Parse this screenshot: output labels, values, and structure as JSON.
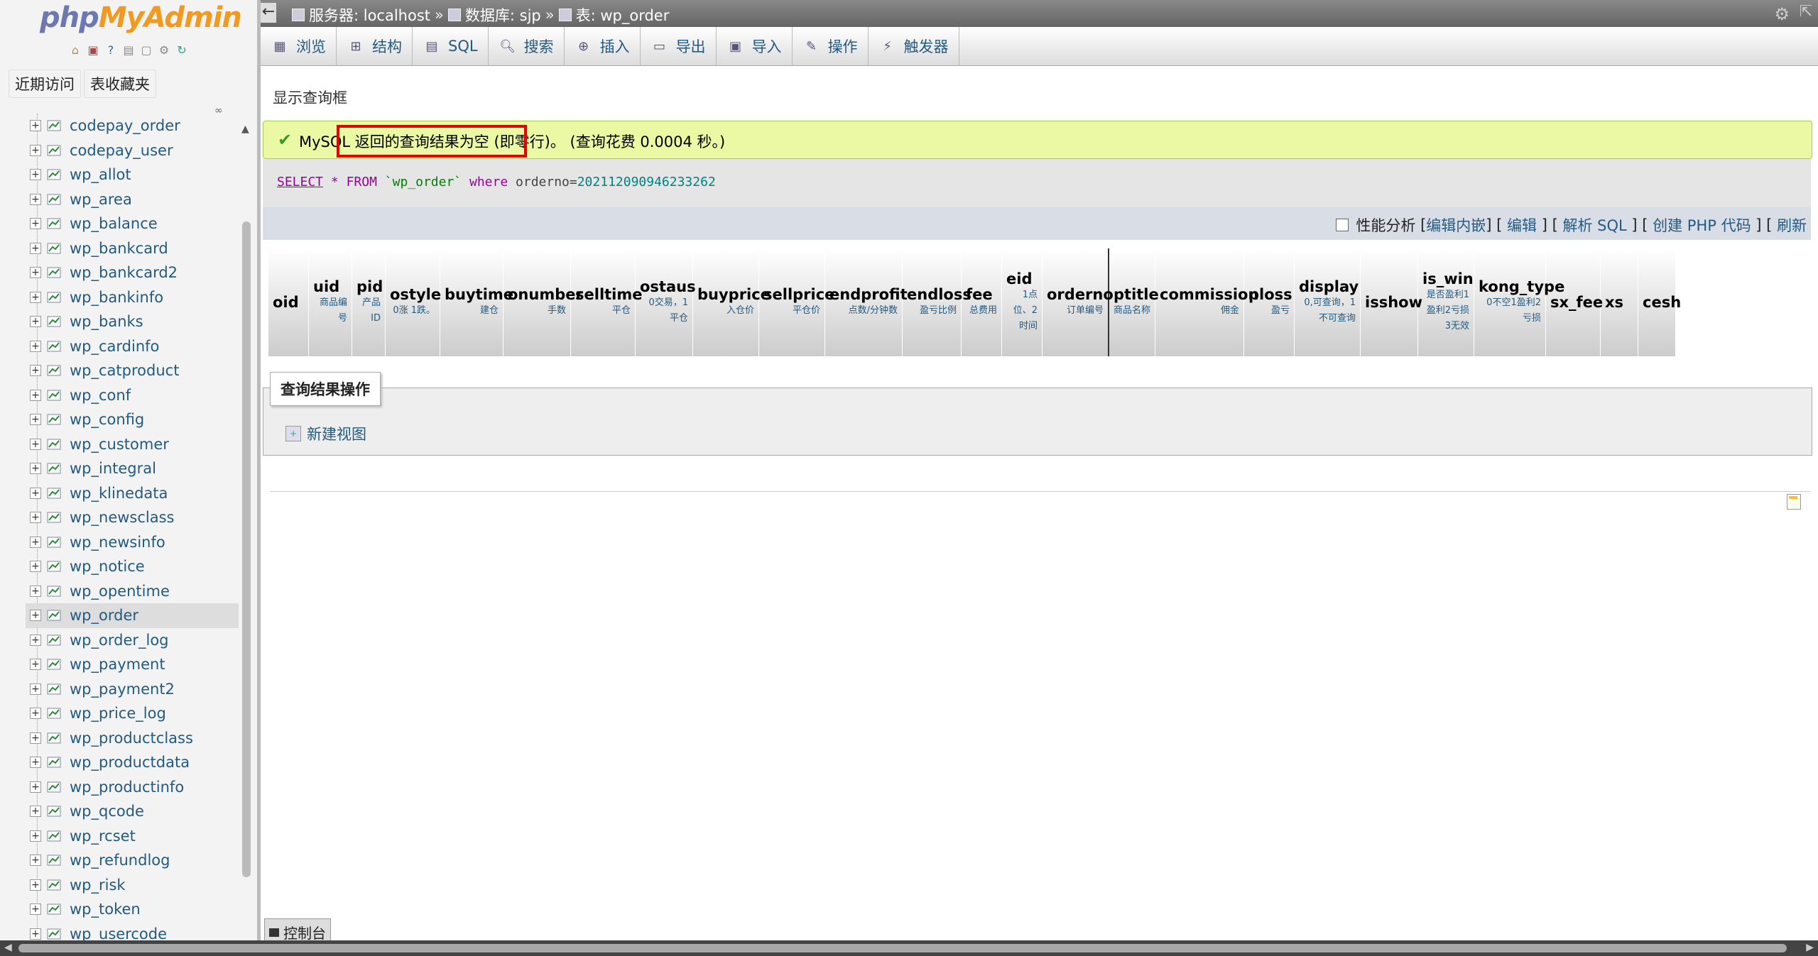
{
  "sidebar": {
    "logo_php": "php",
    "logo_myadmin": "MyAdmin",
    "tabs": [
      "近期访问",
      "表收藏夹"
    ],
    "tables": [
      "codepay_order",
      "codepay_user",
      "wp_allot",
      "wp_area",
      "wp_balance",
      "wp_bankcard",
      "wp_bankcard2",
      "wp_bankinfo",
      "wp_banks",
      "wp_cardinfo",
      "wp_catproduct",
      "wp_conf",
      "wp_config",
      "wp_customer",
      "wp_integral",
      "wp_klinedata",
      "wp_newsclass",
      "wp_newsinfo",
      "wp_notice",
      "wp_opentime",
      "wp_order",
      "wp_order_log",
      "wp_payment",
      "wp_payment2",
      "wp_price_log",
      "wp_productclass",
      "wp_productdata",
      "wp_productinfo",
      "wp_qcode",
      "wp_rcset",
      "wp_refundlog",
      "wp_risk",
      "wp_token",
      "wp_usercode"
    ],
    "active_table": "wp_order"
  },
  "breadcrumb": {
    "server": "服务器: localhost",
    "database": "数据库: sjp",
    "table": "表: wp_order",
    "sep": "»"
  },
  "menu": [
    {
      "label": "浏览",
      "icon": "browse-icon"
    },
    {
      "label": "结构",
      "icon": "structure-icon"
    },
    {
      "label": "SQL",
      "icon": "sql-icon"
    },
    {
      "label": "搜索",
      "icon": "search-icon"
    },
    {
      "label": "插入",
      "icon": "insert-icon"
    },
    {
      "label": "导出",
      "icon": "export-icon"
    },
    {
      "label": "导入",
      "icon": "import-icon"
    },
    {
      "label": "操作",
      "icon": "operations-icon"
    },
    {
      "label": "触发器",
      "icon": "triggers-icon"
    }
  ],
  "main": {
    "show_query_box": "显示查询框",
    "success_message": "MySQL 返回的查询结果为空 (即零行)。 (查询花费 0.0004 秒。)",
    "sql": {
      "select": "SELECT",
      "star": "*",
      "from": "FROM",
      "table": "`wp_order`",
      "where": "where",
      "col": "orderno",
      "op": "=",
      "value": "202112090946233262"
    },
    "tools": {
      "profiling": "性能分析",
      "edit_inline": "编辑内嵌",
      "edit": "编辑",
      "explain": "解析 SQL",
      "php_code": "创建 PHP 代码",
      "refresh": "刷新"
    },
    "ops_legend": "查询结果操作",
    "new_view": "新建视图",
    "console": "控制台"
  },
  "columns": [
    {
      "name": "oid",
      "comment": ""
    },
    {
      "name": "uid",
      "comment": "商品编号"
    },
    {
      "name": "pid",
      "comment": "产品ID"
    },
    {
      "name": "ostyle",
      "comment": "0涨 1跌。"
    },
    {
      "name": "buytime",
      "comment": "建仓"
    },
    {
      "name": "onumber",
      "comment": "手数"
    },
    {
      "name": "selltime",
      "comment": "平仓"
    },
    {
      "name": "ostaus",
      "comment": "0交易，1平仓"
    },
    {
      "name": "buyprice",
      "comment": "入仓价"
    },
    {
      "name": "sellprice",
      "comment": "平仓价"
    },
    {
      "name": "endprofit",
      "comment": "点数/分钟数"
    },
    {
      "name": "endloss",
      "comment": "盈亏比例"
    },
    {
      "name": "fee",
      "comment": "总费用"
    },
    {
      "name": "eid",
      "comment": "1点位、2时间"
    },
    {
      "name": "orderno",
      "comment": "订单编号"
    },
    {
      "name": "ptitle",
      "comment": "商品名称"
    },
    {
      "name": "commission",
      "comment": "佣金"
    },
    {
      "name": "ploss",
      "comment": "盈亏"
    },
    {
      "name": "display",
      "comment": "0,可查询，1不可查询"
    },
    {
      "name": "isshow",
      "comment": ""
    },
    {
      "name": "is_win",
      "comment": "是否盈利1盈利2亏损3无效"
    },
    {
      "name": "kong_type",
      "comment": "0不空1盈利2亏损"
    },
    {
      "name": "sx_fee",
      "comment": ""
    },
    {
      "name": "xs",
      "comment": ""
    },
    {
      "name": "cesh",
      "comment": ""
    }
  ]
}
